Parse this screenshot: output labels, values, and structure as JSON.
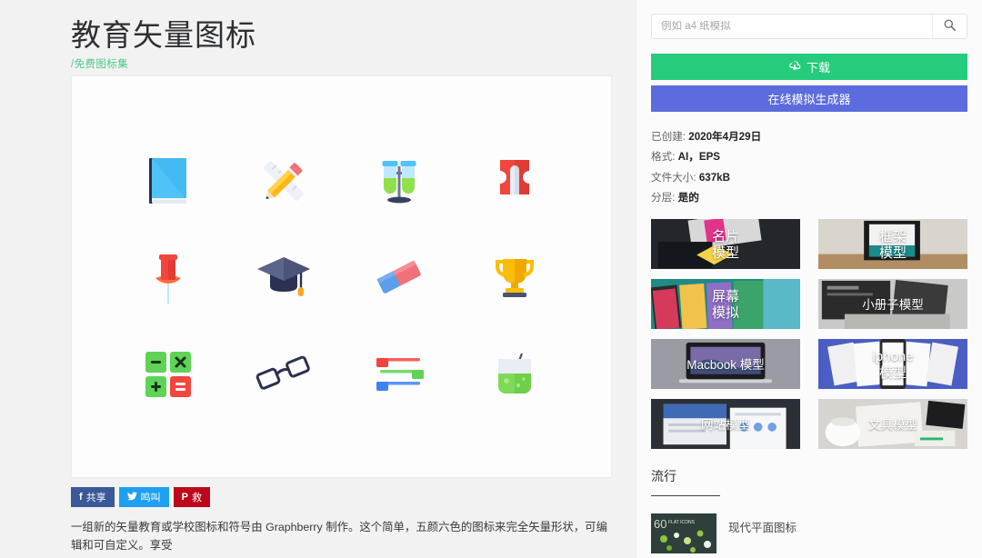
{
  "header": {
    "title": "教育矢量图标",
    "subtitle": "/免费图标集"
  },
  "search": {
    "placeholder": "例如 a4 纸模拟",
    "value": "",
    "icon": "search-icon"
  },
  "actions": {
    "download_label": "下载",
    "download_icon": "cloud-download-icon",
    "download_color": "#25cc7c",
    "mockup_label": "在线模拟生成器",
    "mockup_color": "#5c6bdd"
  },
  "meta": [
    {
      "key": "已创建:",
      "value": "2020年4月29日"
    },
    {
      "key": "格式:",
      "value": "AI，EPS"
    },
    {
      "key": "文件大小:",
      "value": "637kB"
    },
    {
      "key": "分层:",
      "value": "是的"
    }
  ],
  "mockup_thumbs": [
    {
      "label": "名片\n模型",
      "art": "business-card"
    },
    {
      "label": "框架\n模型",
      "art": "frame"
    },
    {
      "label": "屏幕\n模拟",
      "art": "screen"
    },
    {
      "label": "小册子模型",
      "art": "brochure"
    },
    {
      "label": "Macbook 模型",
      "art": "macbook"
    },
    {
      "label": "iphone\n模型",
      "art": "iphone"
    },
    {
      "label": "网站模型",
      "art": "website"
    },
    {
      "label": "文具模型",
      "art": "stationery"
    }
  ],
  "popular": {
    "heading": "流行",
    "items": [
      {
        "title": "现代平面图标",
        "thumb_text": "60",
        "thumb_sub": "FLAT ICONS"
      }
    ]
  },
  "preview": {
    "icons": [
      {
        "name": "book-icon",
        "label": "书本"
      },
      {
        "name": "pencil-ruler-icon",
        "label": "铅笔与直尺"
      },
      {
        "name": "test-tubes-icon",
        "label": "试管架"
      },
      {
        "name": "sharpener-icon",
        "label": "卷笔刀"
      },
      {
        "name": "pushpin-icon",
        "label": "图钉"
      },
      {
        "name": "graduation-cap-icon",
        "label": "学士帽"
      },
      {
        "name": "eraser-icon",
        "label": "橡皮擦"
      },
      {
        "name": "trophy-icon",
        "label": "奖杯"
      },
      {
        "name": "math-symbols-icon",
        "label": "数学符号"
      },
      {
        "name": "glasses-icon",
        "label": "眼镜"
      },
      {
        "name": "books-stack-icon",
        "label": "书堆"
      },
      {
        "name": "beaker-icon",
        "label": "烧杯"
      }
    ]
  },
  "social": [
    {
      "network": "facebook",
      "glyph": "f",
      "label": "共享",
      "color": "#3b5998"
    },
    {
      "network": "twitter",
      "glyph": "🐦",
      "label": "鸣叫",
      "color": "#1da0f1"
    },
    {
      "network": "pinterest",
      "glyph": "P",
      "label": "救",
      "color": "#bd081c"
    }
  ],
  "description": "一组新的矢量教育或学校图标和符号由 Graphberry 制作。这个简单，五颜六色的图标来完全矢量形状，可编辑和可自定义。享受"
}
